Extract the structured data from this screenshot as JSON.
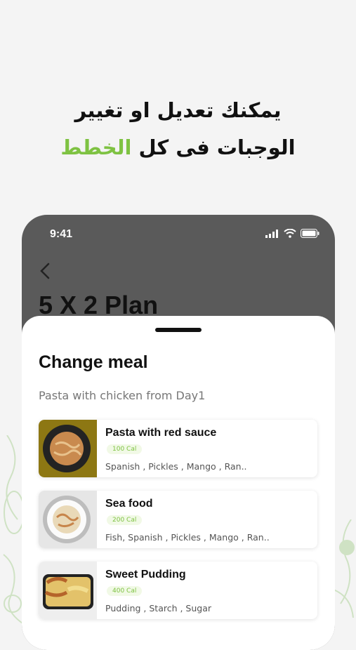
{
  "headline": {
    "line1": "يمكنك تعديل او تغيير",
    "line2_prefix": "الوجبات فى كل",
    "line2_accent": "الخطط"
  },
  "colors": {
    "accent": "#7ec242",
    "dark_header": "#5a5a5a",
    "cal_badge_bg": "#f1f9e6"
  },
  "status_bar": {
    "time": "9:41",
    "icons": [
      "signal-icon",
      "wifi-icon",
      "battery-icon"
    ]
  },
  "header": {
    "back_icon": "chevron-left-icon",
    "title": "5 X 2 Plan"
  },
  "sheet": {
    "title": "Change meal",
    "subtitle": "Pasta with chicken from Day1",
    "meals": [
      {
        "name": "Pasta with red sauce",
        "calories": "100 Cal",
        "ingredients": "Spanish , Pickles  , Mango  , Ran.."
      },
      {
        "name": "Sea food",
        "calories": "200 Cal",
        "ingredients": "Fish, Spanish , Pickles  , Mango  , Ran.."
      },
      {
        "name": "Sweet Pudding",
        "calories": "400 Cal",
        "ingredients": "Pudding , Starch , Sugar"
      }
    ]
  }
}
